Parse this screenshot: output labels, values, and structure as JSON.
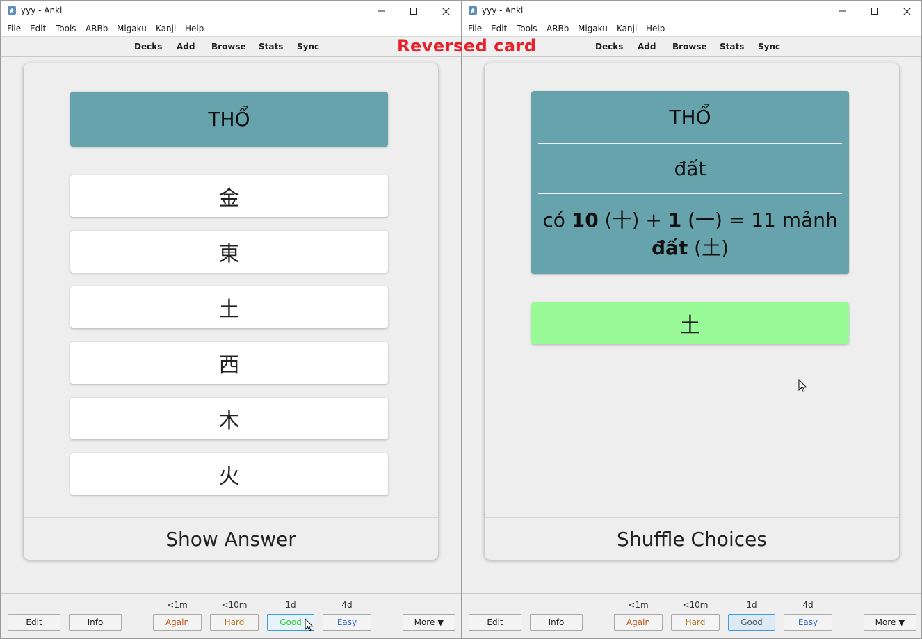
{
  "overlay": {
    "label": "Reversed card",
    "color": "#e8202a"
  },
  "colors": {
    "term_bg": "#67a3ad",
    "correct_bg": "#98fb98",
    "again": "#c35617",
    "hard": "#b2751c",
    "good": "#33cc33",
    "easy": "#3366cc"
  },
  "left": {
    "window_title": "yyy - Anki",
    "menu": [
      "File",
      "Edit",
      "Tools",
      "ARBb",
      "Migaku",
      "Kanji",
      "Help"
    ],
    "toolbar": [
      "Decks",
      "Add",
      "Browse",
      "Stats",
      "Sync"
    ],
    "card": {
      "term": "THỔ",
      "choices": [
        "金",
        "東",
        "土",
        "西",
        "木",
        "火"
      ],
      "footer": "Show Answer"
    },
    "bottom": {
      "edit": "Edit",
      "info": "Info",
      "intervals": [
        "<1m",
        "<10m",
        "1d",
        "4d"
      ],
      "answers": [
        "Again",
        "Hard",
        "Good",
        "Easy"
      ],
      "more": "More ▼"
    }
  },
  "right": {
    "window_title": "yyy - Anki",
    "menu": [
      "File",
      "Edit",
      "Tools",
      "ARBb",
      "Migaku",
      "Kanji",
      "Help"
    ],
    "toolbar": [
      "Decks",
      "Add",
      "Browse",
      "Stats",
      "Sync"
    ],
    "card": {
      "term": "THỔ",
      "meaning": "đất",
      "mnemonic": {
        "p1": "có ",
        "b1": "10",
        "p2": " (十) + ",
        "b2": "1",
        "p3": " (一) = 11 mảnh ",
        "b3": "đất",
        "p4": " (土)"
      },
      "answer": "土",
      "footer": "Shuffle Choices"
    },
    "bottom": {
      "edit": "Edit",
      "info": "Info",
      "intervals": [
        "<1m",
        "<10m",
        "1d",
        "4d"
      ],
      "answers": [
        "Again",
        "Hard",
        "Good",
        "Easy"
      ],
      "more": "More ▼"
    }
  }
}
